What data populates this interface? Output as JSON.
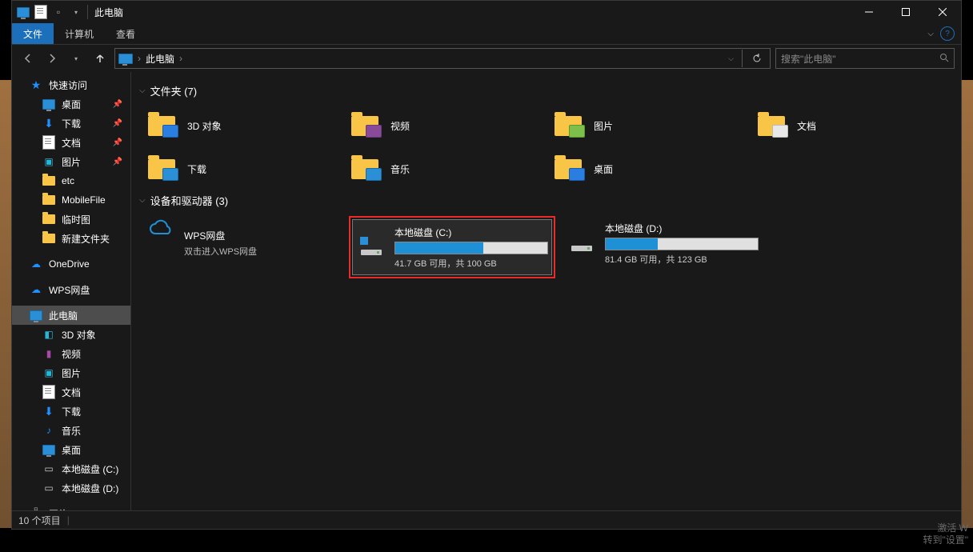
{
  "title": "此电脑",
  "ribbon": {
    "file": "文件",
    "computer": "计算机",
    "view": "查看"
  },
  "addr": {
    "crumb": "此电脑"
  },
  "search": {
    "placeholder": "搜索\"此电脑\""
  },
  "sidebar": {
    "quick": {
      "label": "快速访问",
      "items": [
        {
          "label": "桌面",
          "icon": "monitor",
          "pin": true
        },
        {
          "label": "下载",
          "icon": "download",
          "pin": true
        },
        {
          "label": "文档",
          "icon": "doc",
          "pin": true
        },
        {
          "label": "图片",
          "icon": "pic",
          "pin": true
        },
        {
          "label": "etc",
          "icon": "folder",
          "pin": false
        },
        {
          "label": "MobileFile",
          "icon": "folder",
          "pin": false
        },
        {
          "label": "临时图",
          "icon": "folder",
          "pin": false
        },
        {
          "label": "新建文件夹",
          "icon": "folder",
          "pin": false
        }
      ]
    },
    "onedrive": "OneDrive",
    "wps": "WPS网盘",
    "thispc": {
      "label": "此电脑",
      "items": [
        {
          "label": "3D 对象",
          "icon": "cube"
        },
        {
          "label": "视频",
          "icon": "film"
        },
        {
          "label": "图片",
          "icon": "pic"
        },
        {
          "label": "文档",
          "icon": "doc"
        },
        {
          "label": "下载",
          "icon": "download"
        },
        {
          "label": "音乐",
          "icon": "music"
        },
        {
          "label": "桌面",
          "icon": "monitor"
        },
        {
          "label": "本地磁盘 (C:)",
          "icon": "disk"
        },
        {
          "label": "本地磁盘 (D:)",
          "icon": "disk"
        }
      ]
    },
    "network": "网络"
  },
  "groups": {
    "folders": {
      "title": "文件夹 (7)",
      "items": [
        {
          "label": "3D 对象"
        },
        {
          "label": "视频"
        },
        {
          "label": "图片"
        },
        {
          "label": "文档"
        },
        {
          "label": "下载"
        },
        {
          "label": "音乐"
        },
        {
          "label": "桌面"
        }
      ]
    },
    "drives": {
      "title": "设备和驱动器 (3)",
      "items": [
        {
          "type": "wps",
          "name": "WPS网盘",
          "sub": "双击进入WPS网盘"
        },
        {
          "type": "disk",
          "name": "本地磁盘 (C:)",
          "free": "41.7 GB 可用，共 100 GB",
          "used_pct": 58,
          "selected": true,
          "highlight": true
        },
        {
          "type": "disk",
          "name": "本地磁盘 (D:)",
          "free": "81.4 GB 可用，共 123 GB",
          "used_pct": 34,
          "selected": false,
          "highlight": false
        }
      ]
    }
  },
  "status": {
    "count": "10 个项目"
  },
  "watermark": {
    "l1": "激活 W",
    "l2": "转到\"设置\""
  }
}
